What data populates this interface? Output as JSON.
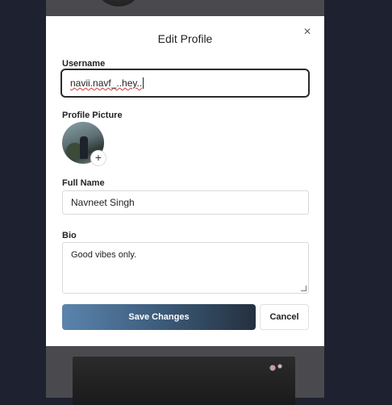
{
  "modal": {
    "title": "Edit Profile",
    "close_icon": "×",
    "username_label": "Username",
    "username_value": "navii.navf_..hey..",
    "profile_picture_label": "Profile Picture",
    "add_picture_icon": "+",
    "full_name_label": "Full Name",
    "full_name_value": "Navneet Singh",
    "bio_label": "Bio",
    "bio_value": "Good vibes only.",
    "save_label": "Save Changes",
    "cancel_label": "Cancel"
  },
  "colors": {
    "page_bg": "#1e2230",
    "overlay": "#4a4a4e",
    "save_gradient_start": "#5b84ad",
    "save_gradient_end": "#24303f"
  },
  "icons": {
    "close": "close-icon",
    "add": "plus-icon"
  }
}
